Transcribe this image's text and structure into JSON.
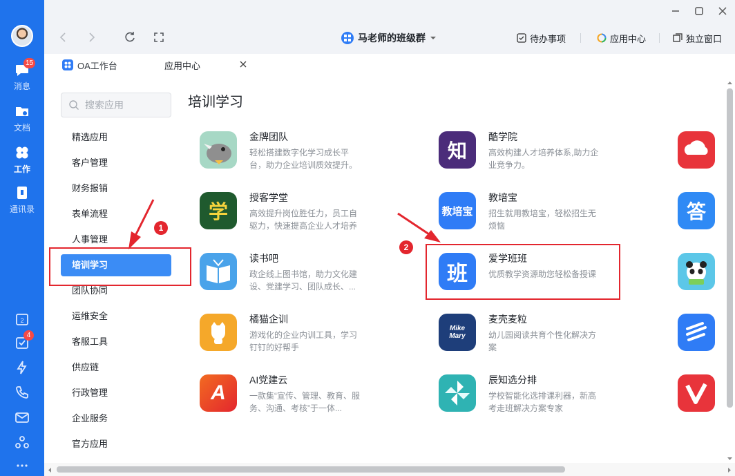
{
  "rail": {
    "items": [
      {
        "label": "消息",
        "badge": "15"
      },
      {
        "label": "文档"
      },
      {
        "label": "工作"
      },
      {
        "label": "通讯录"
      }
    ],
    "tools_badge": "4"
  },
  "topbar": {
    "group_name": "马老师的班级群",
    "todo_label": "待办事项",
    "appcenter_label": "应用中心",
    "standalone_label": "独立窗口"
  },
  "tabs": [
    {
      "label": "OA工作台"
    },
    {
      "label": "应用中心"
    }
  ],
  "search": {
    "placeholder": "搜索应用"
  },
  "categories": [
    "精选应用",
    "客户管理",
    "财务报销",
    "表单流程",
    "人事管理",
    "培训学习",
    "团队协同",
    "运维安全",
    "客服工具",
    "供应链",
    "行政管理",
    "企业服务",
    "官方应用"
  ],
  "section_title": "培训学习",
  "apps": [
    {
      "name": "金牌团队",
      "desc": "轻松搭建数字化学习成长平台，助力企业培训质效提升。"
    },
    {
      "name": "酷学院",
      "desc": "高效构建人才培养体系,助力企业竞争力。",
      "logo_text": "知"
    },
    {
      "name": "授客学堂",
      "desc": "高效提升岗位胜任力，员工自驱力，快速提高企业人才培养",
      "logo_text": "学"
    },
    {
      "name": "教培宝",
      "desc": "招生就用教培宝，轻松招生无烦恼",
      "logo_text": "教培宝"
    },
    {
      "name": "读书吧",
      "desc": "政企线上图书馆，助力文化建设、党建学习、团队成长、..."
    },
    {
      "name": "爱学班班",
      "desc": "优质教学资源助您轻松备授课",
      "logo_text": "班"
    },
    {
      "name": "橘猫企训",
      "desc": "游戏化的企业内训工具，学习钉钉的好帮手"
    },
    {
      "name": "麦壳麦粒",
      "desc": "幼儿园阅读共育个性化解决方案",
      "logo_text": "Mike Mary"
    },
    {
      "name": "AI党建云",
      "desc": "一款集“宣传、管理、教育、服务、沟通、考核”于一体...",
      "logo_text": "A"
    },
    {
      "name": "辰知选分排",
      "desc": "学校智能化选排课利器，新高考走班解决方案专家"
    }
  ],
  "partial_apps": [
    {
      "logo_text": "答"
    }
  ],
  "annotations": {
    "marker1": "1",
    "marker2": "2"
  },
  "colors": {
    "rail": "#1f73ec",
    "accent": "#3b8cf5",
    "annotation": "#e3262e"
  }
}
